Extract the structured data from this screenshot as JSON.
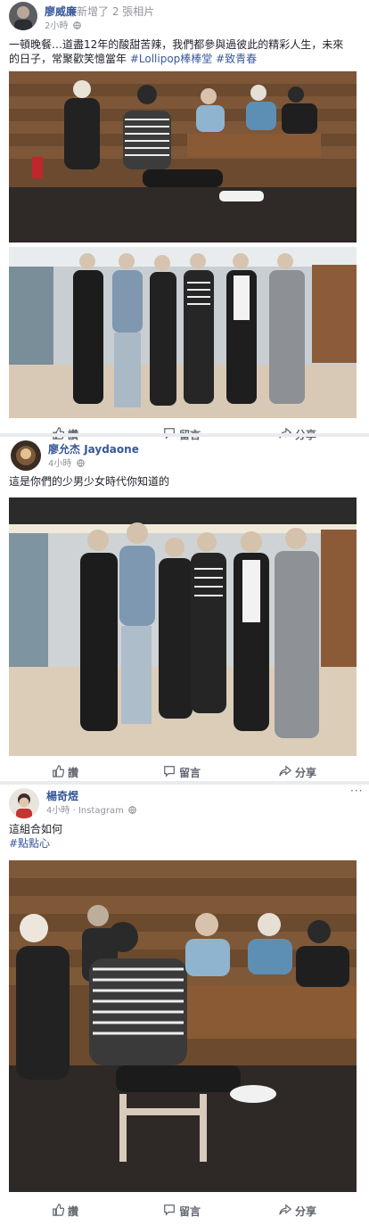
{
  "posts": [
    {
      "author": "廖威廉",
      "action": "新增了 2 張相片",
      "time": "2小時",
      "text_line1": "一頓晚餐…道盡12年的酸甜苦辣，我們都參與過彼此的精彩人生，未來",
      "text_line2_plain": "的日子，常聚歡笑憶當年 ",
      "tag1": "#Lollipop棒棒堂",
      "tag2": "#致青春"
    },
    {
      "author": "廖允杰",
      "author_en": "Jaydaone",
      "time": "4小時",
      "text": "這是你們的少男少女時代你知道的"
    },
    {
      "author": "楊奇煜",
      "time": "4小時",
      "source": "Instagram",
      "text": "這組合如何",
      "tag": "#點點心"
    }
  ],
  "actions": {
    "like": "讚",
    "comment": "留言",
    "share": "分享"
  },
  "more_glyph": "···",
  "source_sep": "·",
  "icons": [
    "avatar",
    "globe-icon",
    "more-options-icon",
    "like-icon",
    "comment-icon",
    "share-icon"
  ]
}
